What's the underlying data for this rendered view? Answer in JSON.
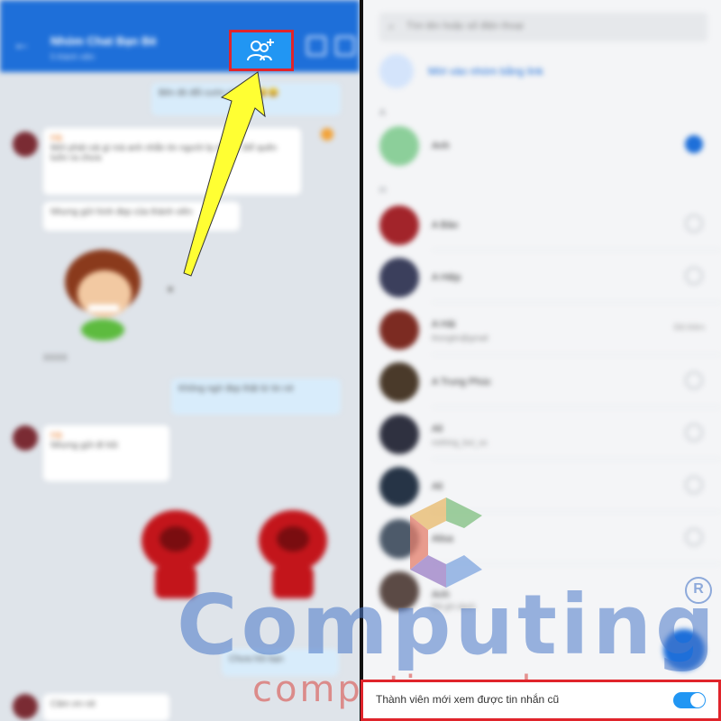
{
  "chat": {
    "header": {
      "back": "←",
      "title": "Nhóm Chat Bạn Bè",
      "subtitle": "5 thành viên"
    },
    "messages": [
      {
        "text": "Bên đó đổi cước nhé 😀😀😀",
        "mine": true
      },
      {
        "sender": "Hà",
        "text": "Mới phát cái gì mà anh nhắn tin người lạ nhiều. Để quên luôn ra chưa"
      },
      {
        "text": "Nhưng gửi hình đẹp của thành viên"
      },
      {
        "caption": "XXXX"
      },
      {
        "text": "Không ngờ đẹp thật từ tin nè",
        "mine": true
      },
      {
        "sender": "Hà",
        "text": "Nhưng gửi đi hỏi"
      },
      {
        "text": "Chưa hỏi bạn",
        "mine": true
      },
      {
        "text": "Cảm ơn nè"
      }
    ]
  },
  "add_members": {
    "search_placeholder": "Tìm tên hoặc số điện thoại",
    "link_text": "Mời vào nhóm bằng link",
    "sections": [
      "A",
      "H"
    ],
    "contacts": [
      {
        "name": "Anh",
        "selected": true
      },
      {
        "name": "A Bảo",
        "sub": ""
      },
      {
        "name": "A Hiệp",
        "sub": ""
      },
      {
        "name": "A Hải",
        "sub": "thongtin@gmail",
        "note": "Đã thêm"
      },
      {
        "name": "A Trung Phúc",
        "sub": ""
      },
      {
        "name": "Ali",
        "sub": "nothing_but_us"
      },
      {
        "name": "Ali",
        "sub": ""
      },
      {
        "name": "Alisa",
        "sub": ""
      },
      {
        "name": "Anh",
        "sub": "Đã ghi danh"
      }
    ]
  },
  "toggle": {
    "label": "Thành viên mới xem được tin nhắn cũ",
    "on": true
  },
  "watermark": {
    "brand": "Computing",
    "url": "computing.edu.vn",
    "reg": "R"
  },
  "colors": {
    "accent": "#2196f3",
    "highlight": "#e0242b",
    "arrow": "#ffff33"
  },
  "icons": {
    "add_member": "add-member-icon",
    "arrow": "arrow-pointer-icon"
  }
}
